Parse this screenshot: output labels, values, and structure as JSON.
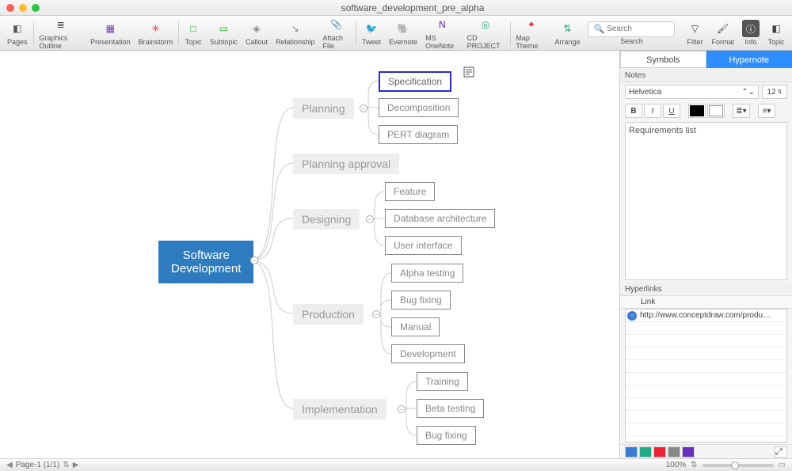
{
  "window": {
    "title": "software_development_pre_alpha"
  },
  "toolbar": {
    "items": [
      {
        "label": "Pages",
        "name": "pages",
        "color": "#555",
        "glyph": "◧"
      },
      {
        "label": "Graphics Outline",
        "name": "graphics-outline",
        "color": "#444",
        "glyph": "≣"
      },
      {
        "label": "Presentation",
        "name": "presentation",
        "color": "#6a2fbf",
        "glyph": "▦"
      },
      {
        "label": "Brainstorm",
        "name": "brainstorm",
        "color": "#e23",
        "glyph": "✳"
      },
      {
        "label": "Topic",
        "name": "topic",
        "color": "#2a2",
        "glyph": "□"
      },
      {
        "label": "Subtopic",
        "name": "subtopic",
        "color": "#2a2",
        "glyph": "▭"
      },
      {
        "label": "Callout",
        "name": "callout",
        "color": "#888",
        "glyph": "◈"
      },
      {
        "label": "Relationship",
        "name": "relationship",
        "color": "#888",
        "glyph": "↘"
      },
      {
        "label": "Attach File",
        "name": "attach-file",
        "color": "#888",
        "glyph": "📎"
      },
      {
        "label": "Tweet",
        "name": "tweet",
        "color": "#1da1f2",
        "glyph": "🐦"
      },
      {
        "label": "Evernote",
        "name": "evernote",
        "color": "#2dbe60",
        "glyph": "🐘"
      },
      {
        "label": "MS OneNote",
        "name": "onenote",
        "color": "#7719aa",
        "glyph": "N"
      },
      {
        "label": "CD PROJECT",
        "name": "cd-project",
        "color": "#2a8",
        "glyph": "◎"
      },
      {
        "label": "Map Theme",
        "name": "map-theme",
        "color": "#e23",
        "glyph": "✦"
      },
      {
        "label": "Arrange",
        "name": "arrange",
        "color": "#2a8",
        "glyph": "⇅"
      }
    ],
    "right": [
      {
        "label": "Filter",
        "name": "filter",
        "glyph": "▽"
      },
      {
        "label": "Format",
        "name": "format",
        "glyph": "🖌"
      },
      {
        "label": "Info",
        "name": "info",
        "glyph": "ⓘ",
        "active": true
      },
      {
        "label": "Topic",
        "name": "topic-panel",
        "glyph": "◧"
      }
    ],
    "search": {
      "placeholder": "Search",
      "label": "Search"
    }
  },
  "side": {
    "tabs": {
      "symbols": "Symbols",
      "hypernote": "Hypernote"
    },
    "notes_label": "Notes",
    "font": "Helvetica",
    "size": "12",
    "formats": {
      "b": "B",
      "i": "I",
      "u": "U"
    },
    "note_text": "Requirements list",
    "hyperlinks_label": "Hyperlinks",
    "link_header": "Link",
    "links": [
      {
        "url": "http://www.conceptdraw.com/produ…"
      }
    ]
  },
  "status": {
    "page": "Page-1 (1/1)",
    "zoom": "100%"
  },
  "map": {
    "root": "Software\nDevelopment",
    "branches": [
      {
        "label": "Planning",
        "children": [
          "Specification",
          "Decomposition",
          "PERT diagram"
        ]
      },
      {
        "label": "Planning approval",
        "children": []
      },
      {
        "label": "Designing",
        "children": [
          "Feature",
          "Database architecture",
          "User interface"
        ]
      },
      {
        "label": "Production",
        "children": [
          "Alpha testing",
          "Bug fixing",
          "Manual",
          "Development"
        ]
      },
      {
        "label": "Implementation",
        "children": [
          "Training",
          "Beta testing",
          "Bug fixing"
        ]
      }
    ]
  }
}
